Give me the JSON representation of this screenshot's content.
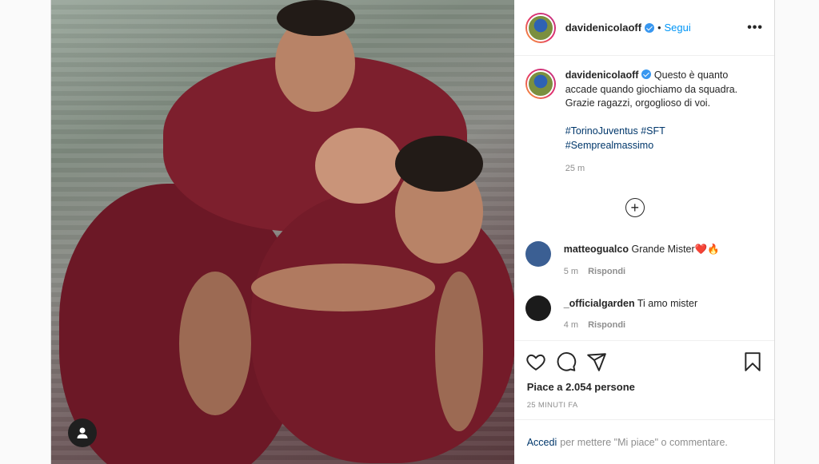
{
  "post": {
    "author": "davidenicolaoff",
    "follow_label": "Segui",
    "more_label": "•••",
    "caption_lines": [
      "Questo è quanto",
      "accade quando giochiamo da squadra.",
      "Grazie ragazzi, orgoglioso di voi."
    ],
    "hashtags": [
      "#TorinoJuventus #SFT",
      "#Semprealmassimo"
    ],
    "caption_time": "25 m",
    "likes": "Piace a 2.054 persone",
    "posted_ago": "25 MINUTI FA",
    "login_link": "Accedi",
    "login_text": "per mettere \"Mi piace\" o commentare."
  },
  "comments": [
    {
      "user": "matteogualco",
      "text": "Grande Mister❤️🔥",
      "time": "5 m",
      "reply": "Rispondi",
      "avatar_color": "#3b5f93"
    },
    {
      "user": "_officialgarden",
      "text": "Ti amo mister",
      "time": "4 m",
      "reply": "Rispondi",
      "avatar_color": "#1b1b1b"
    }
  ],
  "icons": {
    "like": "heart-icon",
    "comment": "comment-bubble-icon",
    "share": "paper-plane-icon",
    "save": "bookmark-icon",
    "load_more": "plus-circle-icon",
    "more": "more-options-icon"
  }
}
